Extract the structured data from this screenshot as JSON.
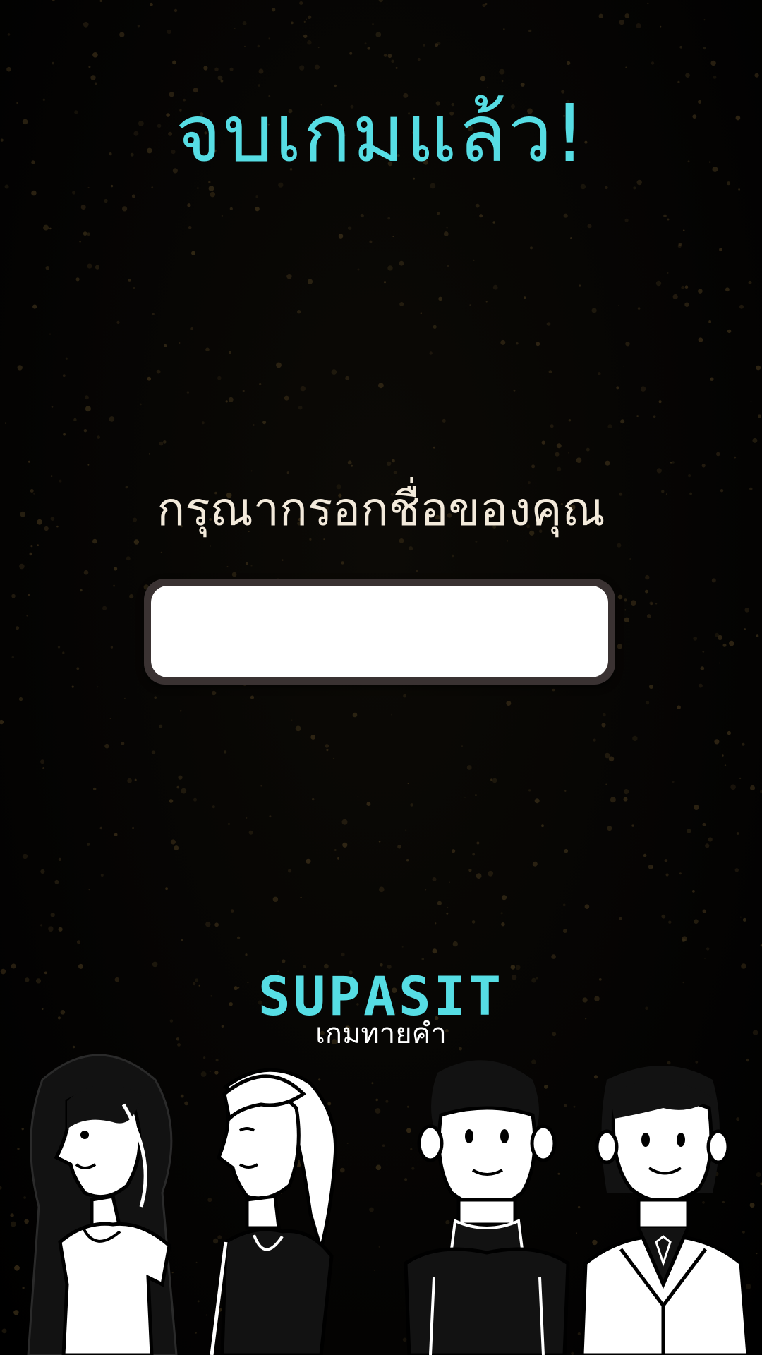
{
  "screen": {
    "title": "จบเกมแล้ว!",
    "prompt": "กรุณากรอกชื่อของคุณ",
    "name_input": {
      "value": "",
      "placeholder": ""
    }
  },
  "branding": {
    "name": "SUPASIT",
    "tagline": "เกมทายคำ"
  },
  "colors": {
    "accent": "#56dde4",
    "prompt_text": "#f3eadb",
    "background": "#000000",
    "speckle": "#3a2e18"
  },
  "illustration": {
    "characters": [
      "woman-long-dark-hair",
      "woman-ponytail",
      "man-turtleneck",
      "woman-blazer"
    ]
  }
}
